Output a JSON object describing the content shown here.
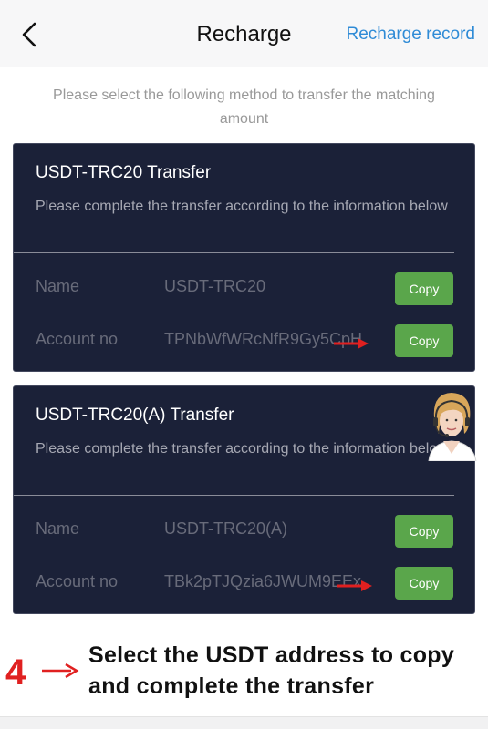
{
  "header": {
    "back_icon": "chevron-left-icon",
    "title": "Recharge",
    "record_link": "Recharge record"
  },
  "instruction": "Please select the following method to transfer the matching amount",
  "methods": [
    {
      "title": "USDT-TRC20 Transfer",
      "description": "Please complete the transfer according to the information below",
      "name_label": "Name",
      "name_value": "USDT-TRC20",
      "account_label": "Account no",
      "account_value": "TPNbWfWRcNfR9Gy5CpH",
      "copy_label": "Copy"
    },
    {
      "title": "USDT-TRC20(A) Transfer",
      "description": "Please complete the transfer according to the information below",
      "name_label": "Name",
      "name_value": "USDT-TRC20(A)",
      "account_label": "Account no",
      "account_value": "TBk2pTJQzia6JWUM9EEx",
      "copy_label": "Copy"
    }
  ],
  "annotation": {
    "step_number": "4",
    "text": "Select the USDT address to copy and complete the transfer"
  },
  "colors": {
    "card_bg": "#1b2138",
    "copy_button": "#5aa64b",
    "link": "#2f8bd6",
    "annotation_red": "#e02020"
  }
}
